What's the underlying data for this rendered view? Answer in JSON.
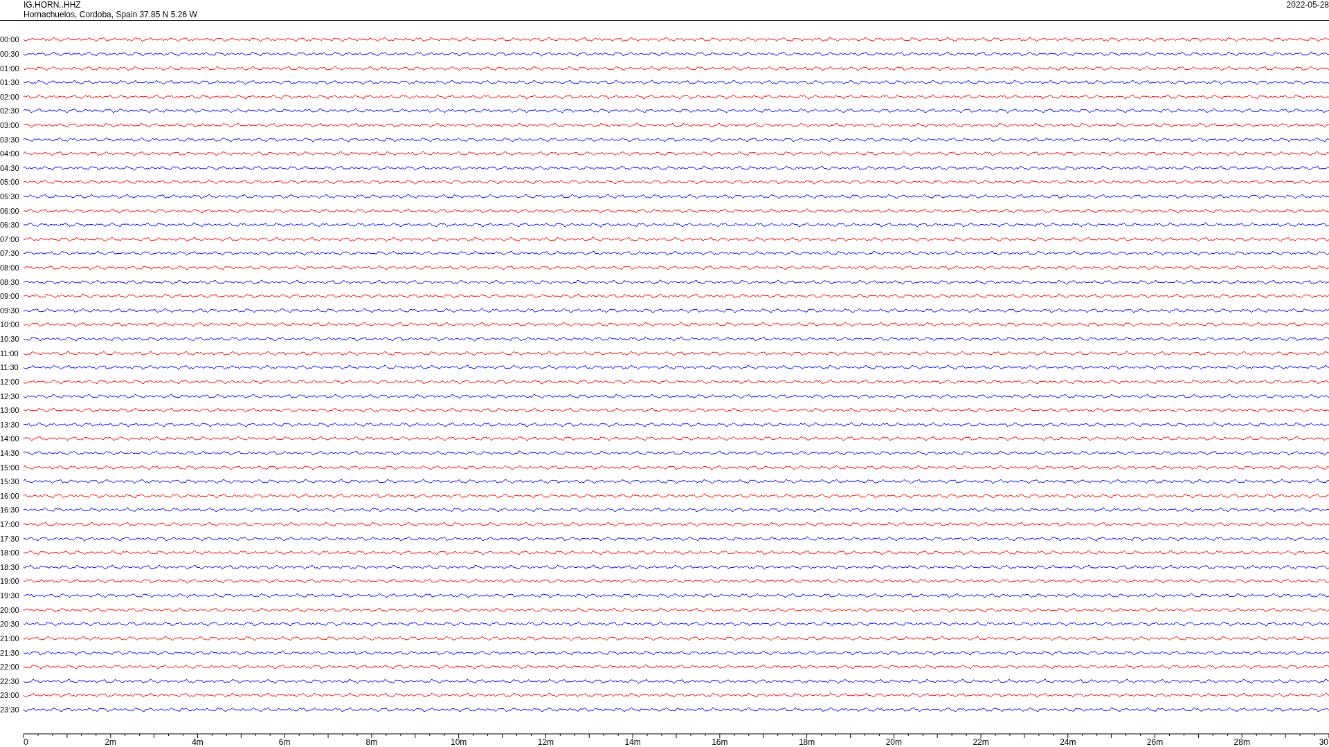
{
  "header": {
    "station": "IG.HORN..HHZ",
    "location": "Hornachuelos, Cordoba, Spain  37.85 N 5.26 W",
    "date": "2022-05-28"
  },
  "traces": [
    {
      "label": "00:00",
      "color": "#ff0000"
    },
    {
      "label": "00:30",
      "color": "#0000ff"
    },
    {
      "label": "01:00",
      "color": "#ff0000"
    },
    {
      "label": "01:30",
      "color": "#0000ff"
    },
    {
      "label": "02:00",
      "color": "#ff0000"
    },
    {
      "label": "02:30",
      "color": "#0000ff"
    },
    {
      "label": "03:00",
      "color": "#ff0000"
    },
    {
      "label": "03:30",
      "color": "#0000ff"
    },
    {
      "label": "04:00",
      "color": "#ff0000"
    },
    {
      "label": "04:30",
      "color": "#0000ff"
    },
    {
      "label": "05:00",
      "color": "#ff0000"
    },
    {
      "label": "05:30",
      "color": "#0000ff"
    },
    {
      "label": "06:00",
      "color": "#ff0000"
    },
    {
      "label": "06:30",
      "color": "#0000ff"
    },
    {
      "label": "07:00",
      "color": "#ff0000"
    },
    {
      "label": "07:30",
      "color": "#0000ff"
    },
    {
      "label": "08:00",
      "color": "#ff0000"
    },
    {
      "label": "08:30",
      "color": "#0000ff"
    },
    {
      "label": "09:00",
      "color": "#ff0000"
    },
    {
      "label": "09:30",
      "color": "#0000ff"
    },
    {
      "label": "10:00",
      "color": "#ff0000"
    },
    {
      "label": "10:30",
      "color": "#0000ff"
    },
    {
      "label": "11:00",
      "color": "#ff0000"
    },
    {
      "label": "11:30",
      "color": "#0000ff"
    },
    {
      "label": "12:00",
      "color": "#ff0000"
    },
    {
      "label": "12:30",
      "color": "#0000ff"
    },
    {
      "label": "13:00",
      "color": "#ff0000"
    },
    {
      "label": "13:30",
      "color": "#0000ff"
    },
    {
      "label": "14:00",
      "color": "#ff0000"
    },
    {
      "label": "14:30",
      "color": "#0000ff"
    },
    {
      "label": "15:00",
      "color": "#ff0000"
    },
    {
      "label": "15:30",
      "color": "#0000ff"
    },
    {
      "label": "16:00",
      "color": "#ff0000"
    },
    {
      "label": "16:30",
      "color": "#0000ff"
    },
    {
      "label": "17:00",
      "color": "#ff0000"
    },
    {
      "label": "17:30",
      "color": "#0000ff"
    },
    {
      "label": "18:00",
      "color": "#ff0000"
    },
    {
      "label": "18:30",
      "color": "#0000ff"
    },
    {
      "label": "19:00",
      "color": "#ff0000"
    },
    {
      "label": "19:30",
      "color": "#0000ff"
    },
    {
      "label": "20:00",
      "color": "#ff0000"
    },
    {
      "label": "20:30",
      "color": "#0000ff"
    },
    {
      "label": "21:00",
      "color": "#ff0000"
    },
    {
      "label": "21:30",
      "color": "#0000ff"
    },
    {
      "label": "22:00",
      "color": "#ff0000"
    },
    {
      "label": "22:30",
      "color": "#0000ff"
    },
    {
      "label": "23:00",
      "color": "#ff0000"
    },
    {
      "label": "23:30",
      "color": "#0000ff"
    }
  ],
  "time_axis": {
    "labels": [
      "0",
      "2m",
      "4m",
      "6m",
      "8m",
      "10m",
      "12m",
      "14m",
      "16m",
      "18m",
      "20m",
      "22m",
      "24m",
      "26m",
      "28m",
      "30"
    ]
  }
}
